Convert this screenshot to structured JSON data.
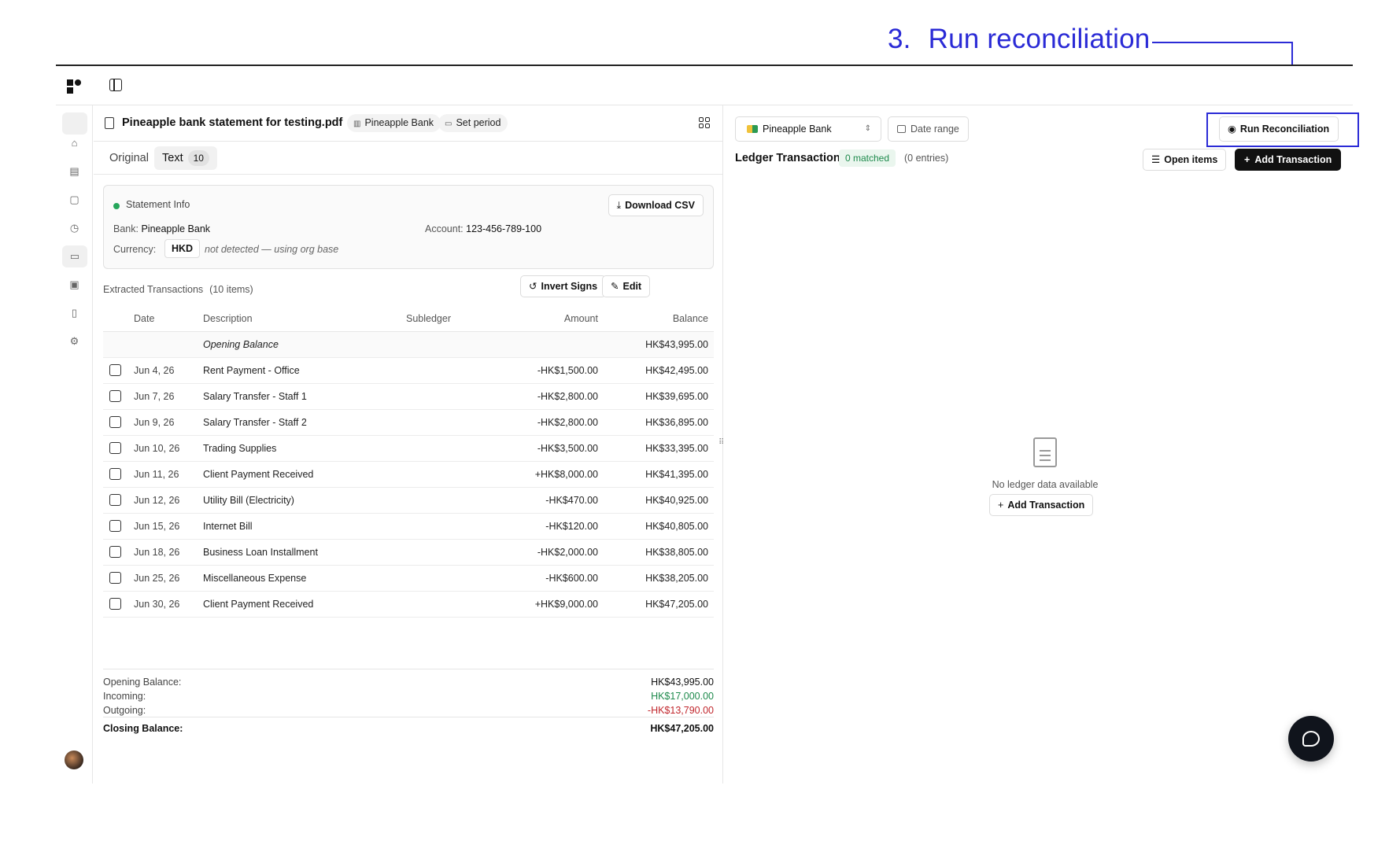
{
  "annotation": {
    "step": "3.",
    "text": "Run reconciliation",
    "color": "#2b2bd6"
  },
  "document": {
    "title": "Pineapple bank statement for testing.pdf",
    "bank_chip": "Pineapple Bank",
    "period_chip": "Set period",
    "tabs": [
      {
        "label": "Original"
      },
      {
        "label": "Text",
        "badge": "10"
      }
    ]
  },
  "statement_info": {
    "title": "Statement Info",
    "download_label": "Download CSV",
    "bank_label": "Bank:",
    "bank_value": "Pineapple Bank",
    "account_label": "Account:",
    "account_value": "123-456-789-100",
    "currency_label": "Currency:",
    "currency_value": "HKD",
    "currency_note": "not detected — using org base"
  },
  "extracted": {
    "title": "Extracted Transactions",
    "count": "(10 items)",
    "invert_label": "Invert Signs",
    "edit_label": "Edit",
    "columns": [
      "Date",
      "Description",
      "Subledger",
      "Amount",
      "Balance"
    ],
    "opening": {
      "description": "Opening Balance",
      "balance": "HK$43,995.00"
    },
    "rows": [
      {
        "date": "Jun 4, 26",
        "description": "Rent Payment - Office",
        "subledger": "",
        "amount": "-HK$1,500.00",
        "balance": "HK$42,495.00"
      },
      {
        "date": "Jun 7, 26",
        "description": "Salary Transfer - Staff 1",
        "subledger": "",
        "amount": "-HK$2,800.00",
        "balance": "HK$39,695.00"
      },
      {
        "date": "Jun 9, 26",
        "description": "Salary Transfer - Staff 2",
        "subledger": "",
        "amount": "-HK$2,800.00",
        "balance": "HK$36,895.00"
      },
      {
        "date": "Jun 10, 26",
        "description": "Trading Supplies",
        "subledger": "",
        "amount": "-HK$3,500.00",
        "balance": "HK$33,395.00"
      },
      {
        "date": "Jun 11, 26",
        "description": "Client Payment Received",
        "subledger": "",
        "amount": "+HK$8,000.00",
        "balance": "HK$41,395.00"
      },
      {
        "date": "Jun 12, 26",
        "description": "Utility Bill (Electricity)",
        "subledger": "",
        "amount": "-HK$470.00",
        "balance": "HK$40,925.00"
      },
      {
        "date": "Jun 15, 26",
        "description": "Internet Bill",
        "subledger": "",
        "amount": "-HK$120.00",
        "balance": "HK$40,805.00"
      },
      {
        "date": "Jun 18, 26",
        "description": "Business Loan Installment",
        "subledger": "",
        "amount": "-HK$2,000.00",
        "balance": "HK$38,805.00"
      },
      {
        "date": "Jun 25, 26",
        "description": "Miscellaneous Expense",
        "subledger": "",
        "amount": "-HK$600.00",
        "balance": "HK$38,205.00"
      },
      {
        "date": "Jun 30, 26",
        "description": "Client Payment Received",
        "subledger": "",
        "amount": "+HK$9,000.00",
        "balance": "HK$47,205.00"
      }
    ]
  },
  "summary": {
    "opening_label": "Opening Balance:",
    "opening_value": "HK$43,995.00",
    "incoming_label": "Incoming:",
    "incoming_value": "HK$17,000.00",
    "outgoing_label": "Outgoing:",
    "outgoing_value": "-HK$13,790.00",
    "closing_label": "Closing Balance:",
    "closing_value": "HK$47,205.00"
  },
  "ledger": {
    "bank_select": "Pineapple Bank",
    "date_range": "Date range",
    "run_label": "Run Reconciliation",
    "title": "Ledger Transactions",
    "matched": "0 matched",
    "entries": "(0 entries)",
    "open_items_label": "Open items",
    "add_label": "Add Transaction",
    "empty_text": "No ledger data available",
    "empty_add_label": "Add Transaction"
  },
  "colors": {
    "negative": "#c1272d",
    "positive": "#1e8a4c",
    "primary_button": "#111111"
  }
}
